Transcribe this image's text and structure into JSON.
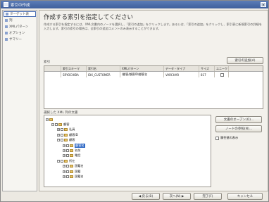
{
  "window": {
    "title": "索引の作成"
  },
  "nav": {
    "items": [
      {
        "label": "ターゲット表"
      },
      {
        "label": "列"
      },
      {
        "label": "XMLパターン"
      },
      {
        "label": "オプション"
      },
      {
        "label": "サマリー"
      }
    ]
  },
  "main": {
    "heading": "作成する索引を指定してください",
    "description": "作成する索引を指定するには、XML文書内のノードを選択し、「索引の追加」をクリックします。あるいは、「索引の追加」をクリックし、索引表に新規索引の詳細を入力します。索引の索引の場合は、全索引の追加コメントのみ表示することができます。",
    "index_section_label": "索引",
    "add_index_button": "索引の追加(A)",
    "table": {
      "headers": [
        "索引スキーマ",
        "索引名",
        "XMLパターン",
        "データ・タイプ",
        "サイズ",
        "ユニーク"
      ],
      "rows": [
        {
          "schema": "SRYOCHIBA",
          "name": "IDX_CUSTOMER",
          "pattern": "/顧客/顧客ID/顧客名",
          "type": "VARCHAR",
          "size": "817",
          "unique": ""
        }
      ]
    },
    "tree_section_label": "選択した XML 列の文書",
    "tree": [
      {
        "label": "",
        "level": 0,
        "exp": "−",
        "check": false
      },
      {
        "label": "顧客",
        "level": 1,
        "exp": "−",
        "check": true
      },
      {
        "label": "社員",
        "level": 2,
        "exp": "+",
        "check": true
      },
      {
        "label": "顧客ID",
        "level": 2,
        "exp": "+",
        "check": true
      },
      {
        "label": "顧客",
        "level": 2,
        "exp": "−",
        "check": true
      },
      {
        "label": "顧客名",
        "level": 3,
        "exp": "+",
        "check": true,
        "selected": true
      },
      {
        "label": "名前",
        "level": 3,
        "exp": "+",
        "check": true
      },
      {
        "label": "電話",
        "level": 3,
        "exp": "+",
        "check": true
      },
      {
        "label": "所在",
        "level": 2,
        "exp": "−",
        "check": true
      },
      {
        "label": "国籍名",
        "level": 3,
        "exp": "+",
        "check": true
      },
      {
        "label": "国籍",
        "level": 3,
        "exp": "+",
        "check": true
      },
      {
        "label": "国籍名",
        "level": 3,
        "exp": "+",
        "check": true
      }
    ],
    "open_doc_button": "文書のオープン(O)...",
    "node_button": "ノードの参照(N)...",
    "show_attributes_label": "属性値の表示"
  },
  "footer": {
    "back": "◀ 戻る(B)",
    "next": "次へ(N) ▶",
    "finish": "完了(F)",
    "cancel": "キャンセル"
  }
}
